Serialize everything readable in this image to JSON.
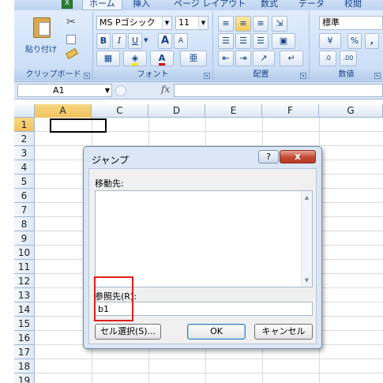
{
  "ribbon": {
    "tabs": [
      {
        "label": "ホーム",
        "active": true
      },
      {
        "label": "挿入"
      },
      {
        "label": "ページ レイアウト"
      },
      {
        "label": "数式"
      },
      {
        "label": "データ"
      },
      {
        "label": "校閲"
      }
    ],
    "clipboard": {
      "paste_label": "貼り付け",
      "group_label": "クリップボード"
    },
    "font": {
      "font_name": "MS Pゴシック",
      "font_size": "11",
      "bold": "B",
      "italic": "I",
      "underline": "U",
      "grow": "A",
      "shrink": "A",
      "font_color": "A",
      "group_label": "フォント"
    },
    "alignment": {
      "group_label": "配置"
    },
    "number": {
      "format": "標準",
      "percent": "%",
      "comma": ",",
      "group_label": "数値"
    }
  },
  "formula_bar": {
    "name_box": "A1",
    "fx": "fx",
    "value": ""
  },
  "grid": {
    "columns": [
      "A",
      "C",
      "D",
      "E",
      "F",
      "G"
    ],
    "rows": [
      "1",
      "2",
      "3",
      "4",
      "5",
      "6",
      "7",
      "8",
      "9",
      "10",
      "11",
      "12",
      "13",
      "14",
      "15",
      "16",
      "17",
      "18",
      "19"
    ],
    "selected_cell": "A1"
  },
  "dialog": {
    "title": "ジャンプ",
    "help": "?",
    "close": "x",
    "goto_label": "移動先:",
    "goto_items": [],
    "ref_label": "参照先(R):",
    "ref_value": "b1",
    "special_button": "セル選択(S)...",
    "ok_button": "OK",
    "cancel_button": "キャンセル"
  },
  "colors": {
    "highlight": "#e01e1e",
    "ribbon": "#c7dcf5",
    "accent": "#15428b"
  }
}
